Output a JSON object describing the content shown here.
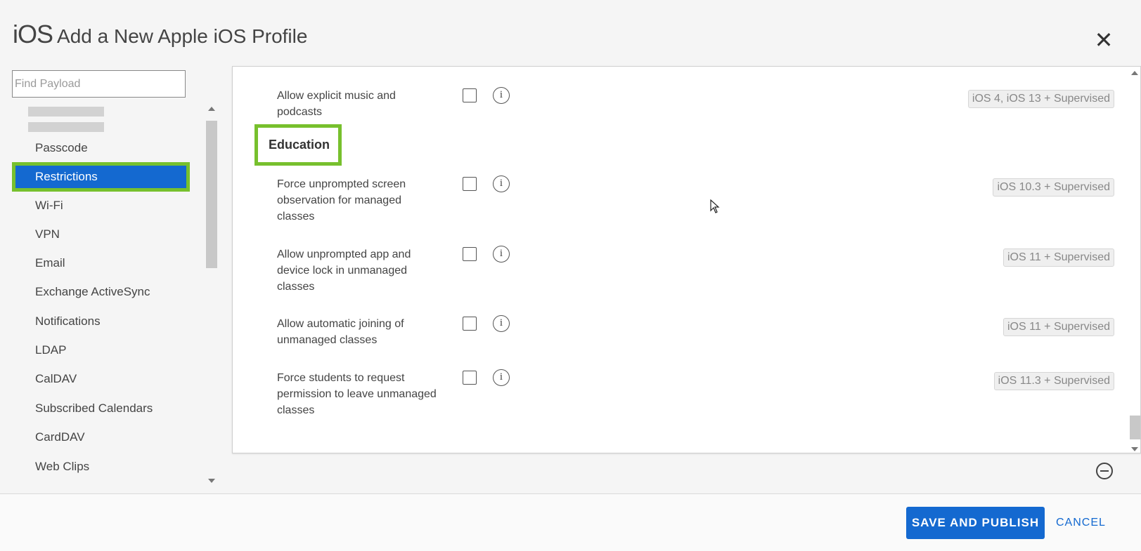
{
  "header": {
    "os_label": "iOS",
    "title": "Add a New Apple iOS Profile",
    "close_icon": "close-icon"
  },
  "sidebar": {
    "search_placeholder": "Find Payload",
    "items": [
      {
        "label": "Passcode",
        "active": false
      },
      {
        "label": "Restrictions",
        "active": true
      },
      {
        "label": "Wi-Fi",
        "active": false
      },
      {
        "label": "VPN",
        "active": false
      },
      {
        "label": "Email",
        "active": false
      },
      {
        "label": "Exchange ActiveSync",
        "active": false
      },
      {
        "label": "Notifications",
        "active": false
      },
      {
        "label": "LDAP",
        "active": false
      },
      {
        "label": "CalDAV",
        "active": false
      },
      {
        "label": "Subscribed Calendars",
        "active": false
      },
      {
        "label": "CardDAV",
        "active": false
      },
      {
        "label": "Web Clips",
        "active": false
      }
    ]
  },
  "main": {
    "rows": [
      {
        "label": "Allow explicit music and podcasts",
        "badge": "iOS 4, iOS 13 + Supervised",
        "checked": false
      },
      {
        "label": "Force unprompted screen observation for managed classes",
        "badge": "iOS 10.3 + Supervised",
        "checked": false
      },
      {
        "label": "Allow unprompted app and device lock in unmanaged classes",
        "badge": "iOS 11 + Supervised",
        "checked": false
      },
      {
        "label": "Allow automatic joining of unmanaged classes",
        "badge": "iOS 11 + Supervised",
        "checked": false
      },
      {
        "label": "Force students to request permission to leave unmanaged classes",
        "badge": "iOS 11.3 + Supervised",
        "checked": false
      }
    ],
    "section_heading": "Education",
    "info_glyph": "i"
  },
  "footer": {
    "save_label": "SAVE AND PUBLISH",
    "cancel_label": "CANCEL"
  },
  "colors": {
    "accent": "#1469d0",
    "highlight": "#77c02d"
  }
}
